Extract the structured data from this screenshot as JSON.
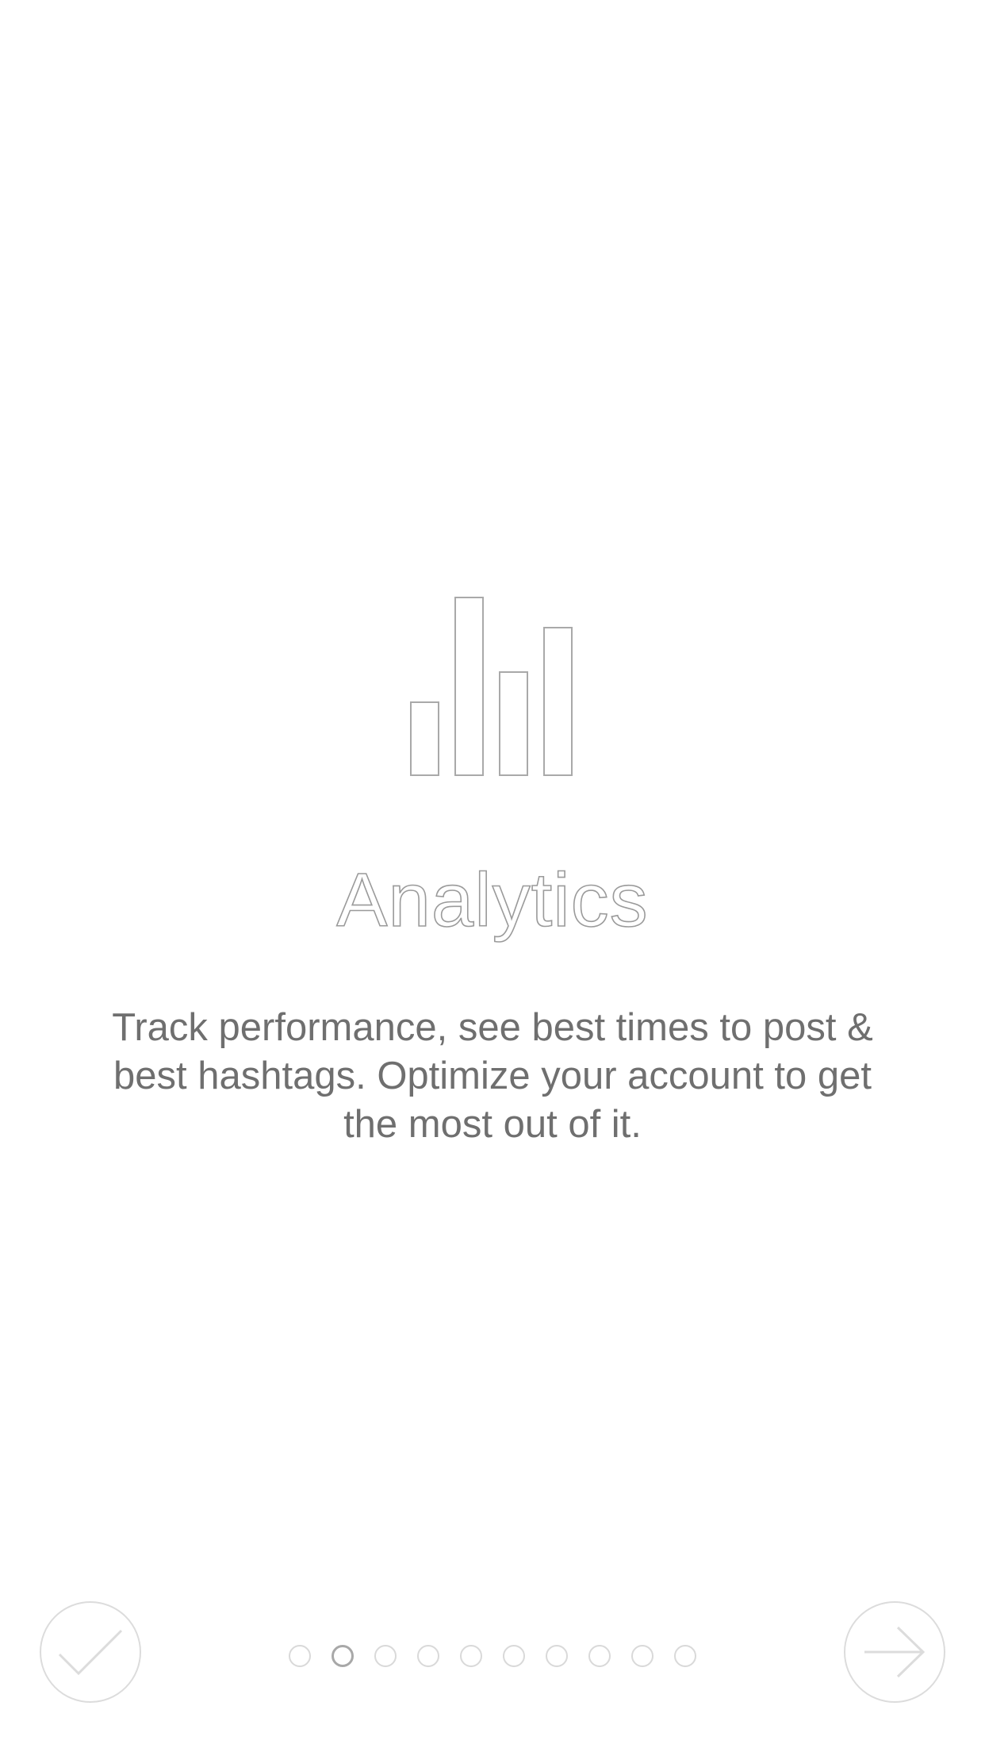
{
  "onboarding": {
    "title": "Analytics",
    "description": "Track performance, see best times to post & best hashtags. Optimize your account to get the most out of it.",
    "icon": "bar-chart-icon"
  },
  "controls": {
    "done_icon": "checkmark-icon",
    "next_icon": "arrow-right-icon"
  },
  "pager": {
    "total_pages": 10,
    "current_page": 2
  },
  "colors": {
    "background": "#ffffff",
    "text": "#6f6f6f",
    "outline": "#9a9a9a",
    "control_border": "#dcdcdc"
  }
}
